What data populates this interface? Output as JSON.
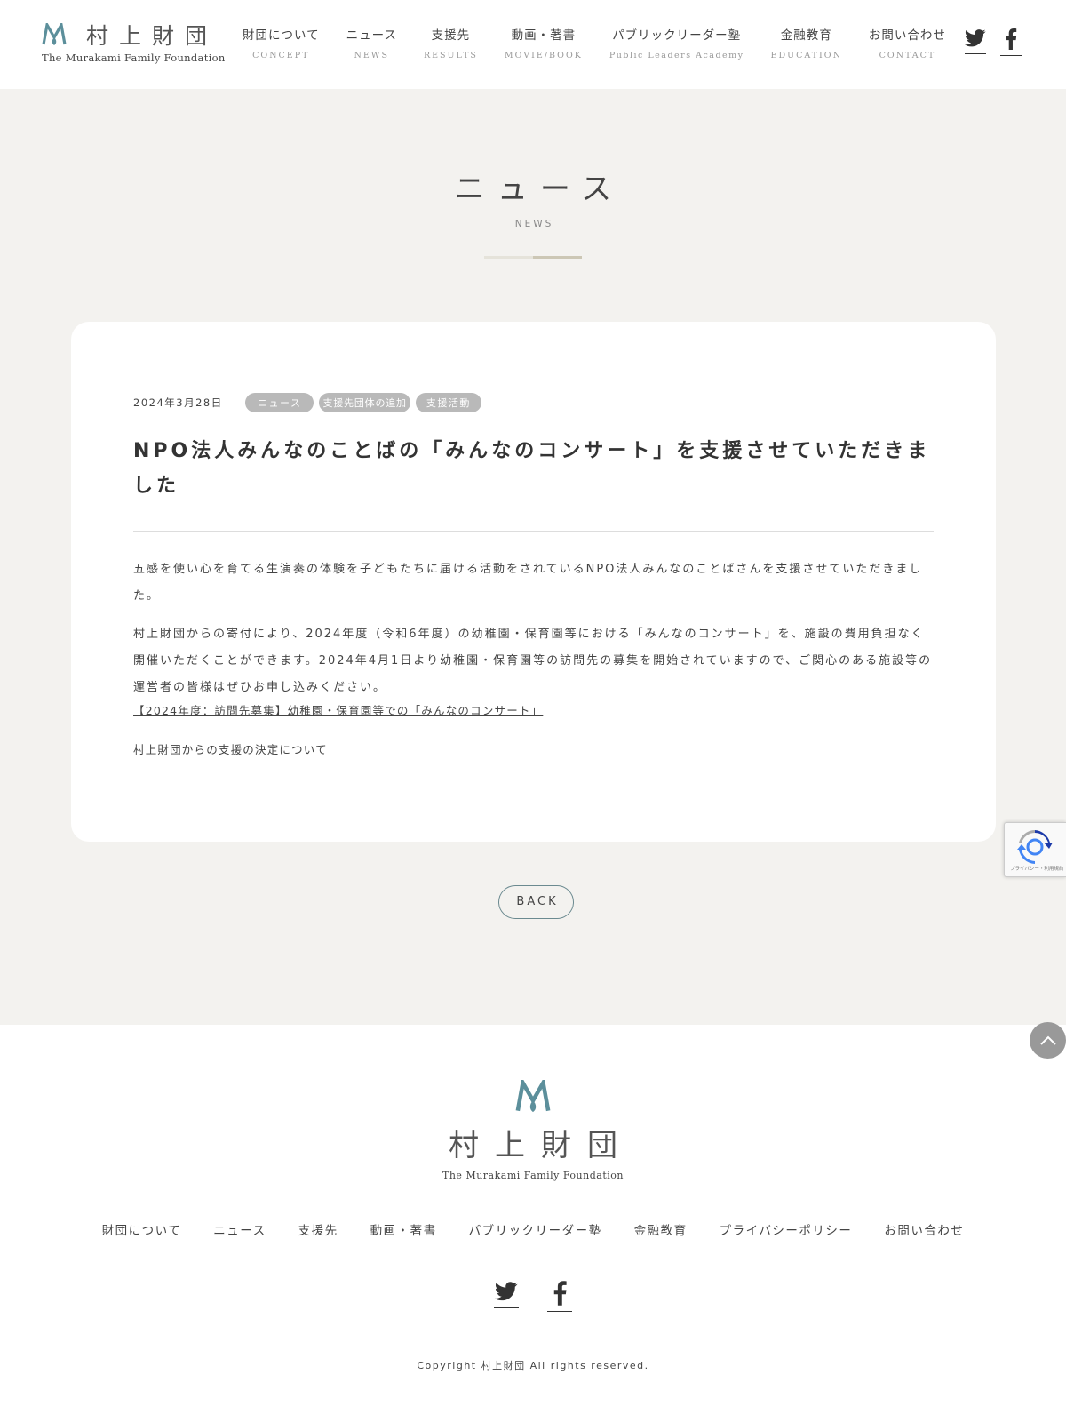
{
  "brand": {
    "kanji": "村上財団",
    "english": "The Murakami Family Foundation",
    "color": "#5c8f9b"
  },
  "nav": [
    {
      "ja": "財団について",
      "en": "CONCEPT"
    },
    {
      "ja": "ニュース",
      "en": "NEWS"
    },
    {
      "ja": "支援先",
      "en": "RESULTS"
    },
    {
      "ja": "動画・著書",
      "en": "MOVIE/BOOK"
    },
    {
      "ja": "パブリックリーダー塾",
      "en": "Public Leaders Academy"
    },
    {
      "ja": "金融教育",
      "en": "EDUCATION"
    },
    {
      "ja": "お問い合わせ",
      "en": "CONTACT"
    }
  ],
  "social": {
    "twitter_icon": "twitter-icon",
    "facebook_icon": "facebook-icon"
  },
  "page": {
    "title_ja": "ニュース",
    "title_en": "NEWS"
  },
  "article": {
    "date": "2024年3月28日",
    "tags": [
      "ニュース",
      "支援先団体の追加",
      "支援活動"
    ],
    "title": "NPO法人みんなのことばの「みんなのコンサート」を支援させていただきました",
    "paragraphs": [
      "五感を使い心を育てる生演奏の体験を子どもたちに届ける活動をされているNPO法人みんなのことばさんを支援させていただきました。",
      "村上財団からの寄付により、2024年度（令和6年度）の幼稚園・保育園等における「みんなのコンサート」を、施設の費用負担なく開催いただくことができます。2024年4月1日より幼稚園・保育園等の訪問先の募集を開始されていますので、ご関心のある施設等の運営者の皆様はぜひお申し込みください。"
    ],
    "links": [
      "【2024年度：訪問先募集】幼稚園・保育園等での「みんなのコンサート」",
      "村上財団からの支援の決定について"
    ]
  },
  "back_label": "BACK",
  "recaptcha_text": "プライバシー・利用規約",
  "footer": {
    "nav": [
      "財団について",
      "ニュース",
      "支援先",
      "動画・著書",
      "パブリックリーダー塾",
      "金融教育",
      "プライバシーポリシー",
      "お問い合わせ"
    ],
    "copyright": "Copyright 村上財団 All rights reserved."
  }
}
